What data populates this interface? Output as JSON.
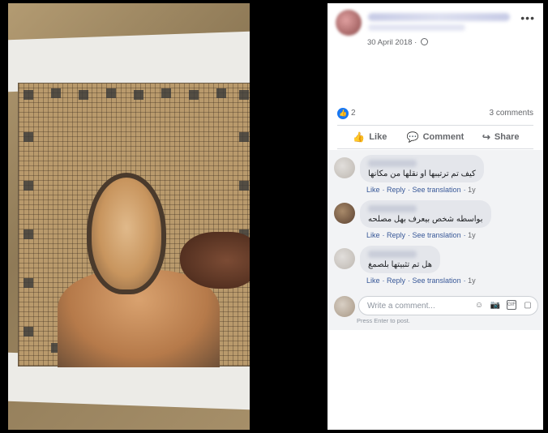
{
  "post": {
    "date": "30 April 2018 ·",
    "more_label": "•••"
  },
  "stats": {
    "likes": "2",
    "comments": "3 comments"
  },
  "actions": [
    {
      "label": "Like",
      "icon": "like-icon"
    },
    {
      "label": "Comment",
      "icon": "comment-icon"
    },
    {
      "label": "Share",
      "icon": "share-icon"
    }
  ],
  "comments": [
    {
      "text": "كيف تم ترتيبها او نقلها من مكانها",
      "like": "Like",
      "reply": "Reply",
      "translate": "See translation",
      "time": "1y"
    },
    {
      "text": "بواسطه شخص بيعرف بهل مصلحه",
      "like": "Like",
      "reply": "Reply",
      "translate": "See translation",
      "time": "1y"
    },
    {
      "text": "هل تم تثبيتها بلصمغ",
      "like": "Like",
      "reply": "Reply",
      "translate": "See translation",
      "time": "1y"
    }
  ],
  "composer": {
    "placeholder": "Write a comment...",
    "hint": "Press Enter to post."
  },
  "colors": {
    "link": "#385898",
    "accent": "#1877f2"
  }
}
